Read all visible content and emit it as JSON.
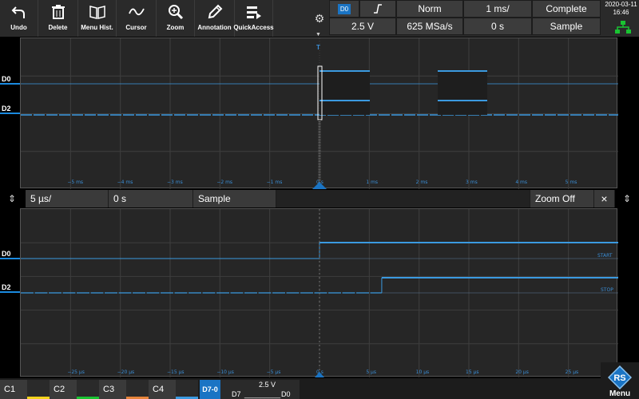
{
  "toolbar": {
    "buttons": [
      {
        "label": "Undo",
        "icon": "undo-icon"
      },
      {
        "label": "Delete",
        "icon": "trash-icon"
      },
      {
        "label": "Menu Hist.",
        "icon": "book-icon"
      },
      {
        "label": "Cursor",
        "icon": "cursor-wave-icon"
      },
      {
        "label": "Zoom",
        "icon": "zoom-icon"
      },
      {
        "label": "Annotation",
        "icon": "pen-icon"
      },
      {
        "label": "QuickAccess",
        "icon": "quickaccess-icon"
      }
    ]
  },
  "status": {
    "trigger_source": "D0",
    "trigger_slope_icon": "rising-edge-icon",
    "trigger_mode": "Norm",
    "timebase": "1 ms/",
    "acq_state": "Complete",
    "level": "2.5 V",
    "sample_rate": "625 MSa/s",
    "position": "0 s",
    "acq_mode": "Sample",
    "date": "2020-03-11",
    "time": "16:46"
  },
  "top_panel": {
    "channels": [
      "D0",
      "D2"
    ],
    "x_ticks": [
      "−5 ms",
      "−4 ms",
      "−3 ms",
      "−2 ms",
      "−1 ms",
      "0 s",
      "1 ms",
      "2 ms",
      "3 ms",
      "4 ms",
      "5 ms"
    ],
    "trigger_marker": "T"
  },
  "zoom_bar": {
    "timebase": "5 µs/",
    "position": "0 s",
    "mode": "Sample",
    "zoom_label": "Zoom Off",
    "close_label": "×"
  },
  "bottom_panel": {
    "channels": [
      "D0",
      "D2"
    ],
    "x_ticks": [
      "−25 µs",
      "−20 µs",
      "−15 µs",
      "−10 µs",
      "−5 µs",
      "0 s",
      "5 µs",
      "10 µs",
      "15 µs",
      "20 µs",
      "25 µs"
    ],
    "signal_labels": [
      "START",
      "STOP"
    ]
  },
  "bottom_bar": {
    "channels": [
      {
        "label": "C1",
        "color": "#f2d21b"
      },
      {
        "label": "C2",
        "color": "#19c332"
      },
      {
        "label": "C3",
        "color": "#e6843a"
      },
      {
        "label": "C4",
        "color": "#3b9ae0"
      }
    ],
    "digital": {
      "label": "D7-0",
      "level": "2.5 V",
      "bits_left": "D7",
      "bits_right": "D0",
      "bits_pattern": "_________"
    },
    "menu_label": "Menu"
  },
  "colors": {
    "accent": "#1a74c4",
    "trace": "#3b9ae0",
    "grid": "#3e3e3e"
  }
}
